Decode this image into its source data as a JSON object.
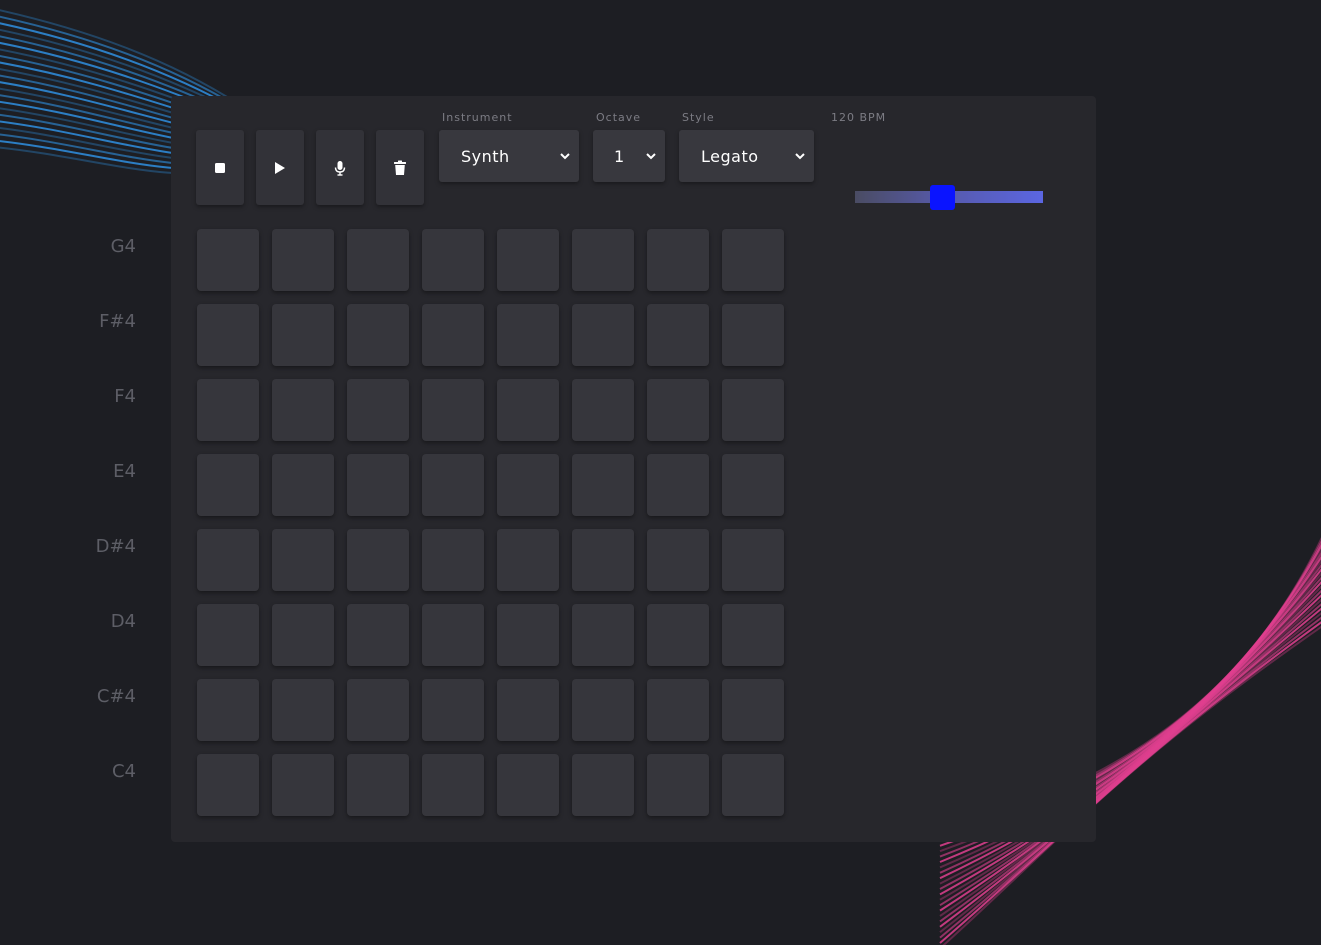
{
  "toolbar": {
    "buttons": [
      {
        "name": "stop-button",
        "icon": "stop-icon"
      },
      {
        "name": "play-button",
        "icon": "play-icon"
      },
      {
        "name": "record-button",
        "icon": "microphone-icon"
      },
      {
        "name": "clear-button",
        "icon": "trash-icon"
      }
    ]
  },
  "instrument": {
    "label": "Instrument",
    "value": "Synth"
  },
  "octave": {
    "label": "Octave",
    "value": "1"
  },
  "style": {
    "label": "Style",
    "value": "Legato"
  },
  "tempo": {
    "label": "120 BPM",
    "bpm": 120,
    "slider_fraction": 0.4
  },
  "grid": {
    "rows": [
      "G4",
      "F#4",
      "F4",
      "E4",
      "D#4",
      "D4",
      "C#4",
      "C4"
    ],
    "steps": 8
  },
  "colors": {
    "background": "#1d1e23",
    "panel": "#27272c",
    "pad": "#36363c",
    "wave_left": "#2f8fe0",
    "wave_right": "#e0408f",
    "slider_thumb": "#0a14ff"
  }
}
